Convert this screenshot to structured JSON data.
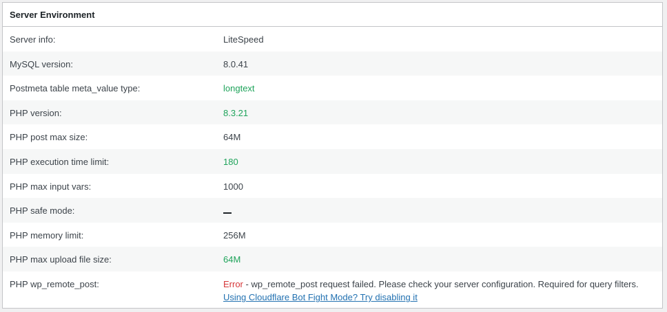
{
  "panel": {
    "title": "Server Environment"
  },
  "rows": [
    {
      "label": "Server info:",
      "value": "LiteSpeed"
    },
    {
      "label": "MySQL version:",
      "value": "8.0.41"
    },
    {
      "label": "Postmeta table meta_value type:",
      "value": "longtext"
    },
    {
      "label": "PHP version:",
      "value": "8.3.21"
    },
    {
      "label": "PHP post max size:",
      "value": "64M"
    },
    {
      "label": "PHP execution time limit:",
      "value": "180"
    },
    {
      "label": "PHP max input vars:",
      "value": "1000"
    },
    {
      "label": "PHP safe mode:",
      "value": "—"
    },
    {
      "label": "PHP memory limit:",
      "value": "256M"
    },
    {
      "label": "PHP max upload file size:",
      "value": "64M"
    },
    {
      "label": "PHP wp_remote_post:",
      "error_word": "Error",
      "error_text": " - wp_remote_post request failed. Please check your server configuration. Required for query filters.",
      "link": "Using Cloudflare Bot Fight Mode? Try disabling it"
    }
  ],
  "colors": {
    "ok": "#1ea35a",
    "error": "#d63638",
    "link": "#2271b1"
  }
}
